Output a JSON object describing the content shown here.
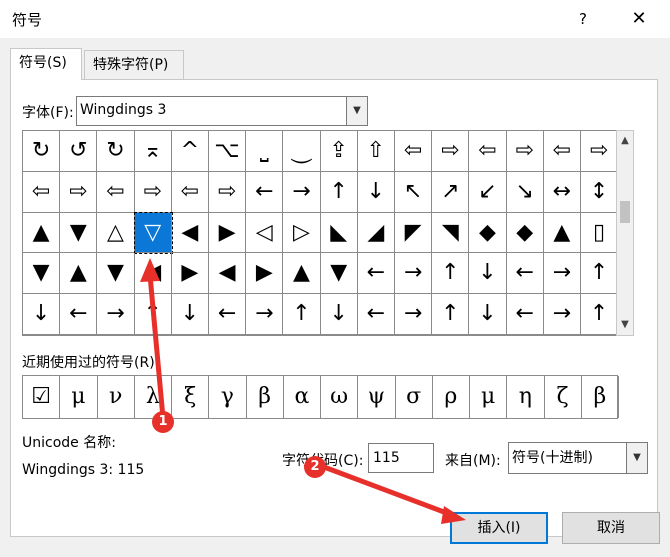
{
  "window": {
    "title": "符号",
    "help": "?",
    "close": "✕"
  },
  "tabs": [
    {
      "label": "符号(S)"
    },
    {
      "label": "特殊字符(P)"
    }
  ],
  "font": {
    "label": "字体(F):",
    "value": "Wingdings 3"
  },
  "grid": {
    "rows": [
      [
        "↻",
        "↺",
        "↻",
        "⌅",
        "^",
        "⌥",
        "⎵",
        "⏝",
        "⇪",
        "⇧",
        "⇦",
        "⇨",
        "⇦",
        "⇨",
        "⇦",
        "⇨"
      ],
      [
        "⇦",
        "⇨",
        "⇦",
        "⇨",
        "⇦",
        "⇨",
        "←",
        "→",
        "↑",
        "↓",
        "↖",
        "↗",
        "↙",
        "↘",
        "↔",
        "↕"
      ],
      [
        "▲",
        "▼",
        "△",
        "▽",
        "◀",
        "▶",
        "◁",
        "▷",
        "◣",
        "◢",
        "◤",
        "◥",
        "◆",
        "◆",
        "▲",
        "▯"
      ],
      [
        "▼",
        "▲",
        "▼",
        "◀",
        "▶",
        "◀",
        "▶",
        "▲",
        "▼",
        "←",
        "→",
        "↑",
        "↓",
        "←",
        "→",
        "↑"
      ],
      [
        "↓",
        "←",
        "→",
        "↑",
        "↓",
        "←",
        "→",
        "↑",
        "↓",
        "←",
        "→",
        "↑",
        "↓",
        "←",
        "→",
        "↑"
      ]
    ],
    "selected_index": 3,
    "selected_row": 2
  },
  "recent": {
    "label": "近期使用过的符号(R):",
    "symbols": [
      "☑",
      "μ",
      "ν",
      "λ",
      "ξ",
      "γ",
      "β",
      "α",
      "ω",
      "ψ",
      "σ",
      "ρ",
      "μ",
      "η",
      "ζ",
      "β"
    ]
  },
  "unicode": {
    "label": "Unicode 名称:",
    "value": "Wingdings 3: 115"
  },
  "charcode": {
    "label": "字符代码(C):",
    "value": "115"
  },
  "from": {
    "label": "来自(M):",
    "value": "符号(十进制)"
  },
  "buttons": {
    "insert": "插入(I)",
    "cancel": "取消"
  },
  "annotations": {
    "marker1": "1",
    "marker2": "2",
    "color": "#e8302a"
  }
}
